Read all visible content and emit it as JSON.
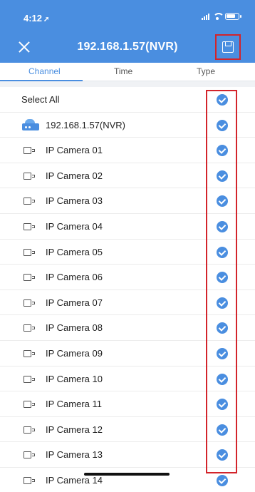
{
  "status": {
    "time": "4:12"
  },
  "nav": {
    "title": "192.168.1.57(NVR)",
    "close_icon": "close-icon",
    "save_icon": "save-icon"
  },
  "tabs": [
    {
      "label": "Channel",
      "active": true
    },
    {
      "label": "Time",
      "active": false
    },
    {
      "label": "Type",
      "active": false
    }
  ],
  "list": {
    "select_all": "Select All",
    "device": "192.168.1.57(NVR)",
    "cameras": [
      "IP Camera 01",
      "IP Camera 02",
      "IP Camera 03",
      "IP Camera 04",
      "IP Camera 05",
      "IP Camera 06",
      "IP Camera 07",
      "IP Camera 08",
      "IP Camera 09",
      "IP Camera 10",
      "IP Camera 11",
      "IP Camera 12",
      "IP Camera 13",
      "IP Camera 14"
    ]
  },
  "colors": {
    "accent": "#4a8ee0",
    "highlight": "#d3242b"
  }
}
